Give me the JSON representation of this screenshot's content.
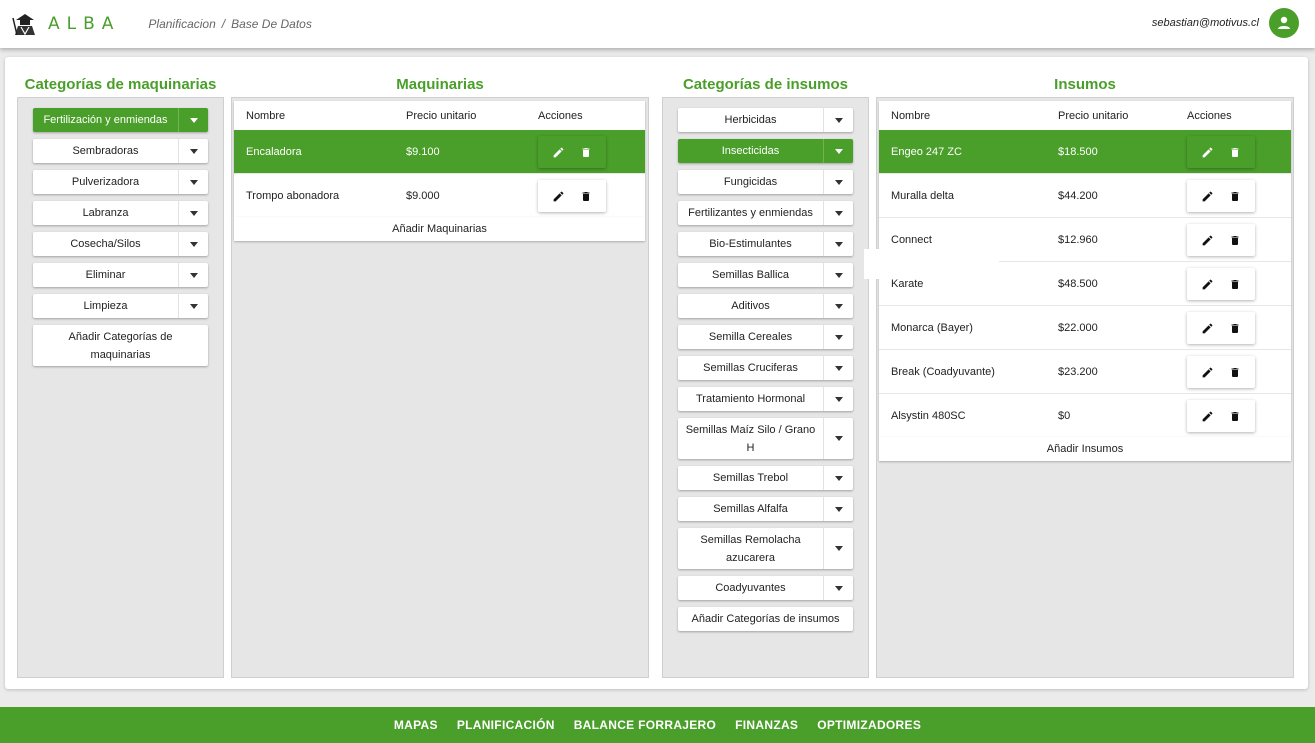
{
  "header": {
    "logo_text": "ALBA",
    "breadcrumb": [
      "Planificacion",
      "/",
      "Base De Datos"
    ],
    "user_email": "sebastian@motivus.cl"
  },
  "sections": {
    "maq_categories_title": "Categorías de maquinarias",
    "maq_title": "Maquinarias",
    "ins_categories_title": "Categorías de insumos",
    "ins_title": "Insumos"
  },
  "maq_categories": {
    "items": [
      {
        "label": "Fertilización y enmiendas",
        "active": true
      },
      {
        "label": "Sembradoras"
      },
      {
        "label": "Pulverizadora"
      },
      {
        "label": "Labranza"
      },
      {
        "label": "Cosecha/Silos"
      },
      {
        "label": "Eliminar"
      },
      {
        "label": "Limpieza"
      }
    ],
    "add_label": "Añadir Categorías de maquinarias"
  },
  "maq_table": {
    "headers": [
      "Nombre",
      "Precio unitario",
      "Acciones"
    ],
    "rows": [
      {
        "name": "Encaladora",
        "price": "$9.100",
        "active": true
      },
      {
        "name": "Trompo abonadora",
        "price": "$9.000"
      }
    ],
    "add_label": "Añadir Maquinarias"
  },
  "ins_categories": {
    "items": [
      {
        "label": "Herbicidas"
      },
      {
        "label": "Insecticidas",
        "active": true
      },
      {
        "label": "Fungicidas"
      },
      {
        "label": "Fertilizantes y enmiendas"
      },
      {
        "label": "Bio-Estimulantes"
      },
      {
        "label": "Semillas Ballica"
      },
      {
        "label": "Aditivos"
      },
      {
        "label": "Semilla Cereales"
      },
      {
        "label": "Semillas Cruciferas"
      },
      {
        "label": "Tratamiento Hormonal"
      },
      {
        "label": "Semillas Maíz Silo / Grano H"
      },
      {
        "label": "Semillas Trebol"
      },
      {
        "label": "Semillas Alfalfa"
      },
      {
        "label": "Semillas Remolacha azucarera"
      },
      {
        "label": "Coadyuvantes"
      }
    ],
    "add_label": "Añadir Categorías de insumos"
  },
  "ins_table": {
    "headers": [
      "Nombre",
      "Precio unitario",
      "Acciones"
    ],
    "rows": [
      {
        "name": "Engeo 247 ZC",
        "price": "$18.500",
        "active": true
      },
      {
        "name": "Muralla delta",
        "price": "$44.200"
      },
      {
        "name": "Connect",
        "price": "$12.960"
      },
      {
        "name": "Karate",
        "price": "$48.500"
      },
      {
        "name": "Monarca (Bayer)",
        "price": "$22.000"
      },
      {
        "name": "Break (Coadyuvante)",
        "price": "$23.200"
      },
      {
        "name": "Alsystin 480SC",
        "price": "$0"
      }
    ],
    "add_label": "Añadir Insumos"
  },
  "footer": {
    "links": [
      "MAPAS",
      "PLANIFICACIÓN",
      "BALANCE FORRAJERO",
      "FINANZAS",
      "OPTIMIZADORES"
    ]
  },
  "colors": {
    "accent": "#4a9e2a",
    "panel": "#e6e6e6"
  }
}
